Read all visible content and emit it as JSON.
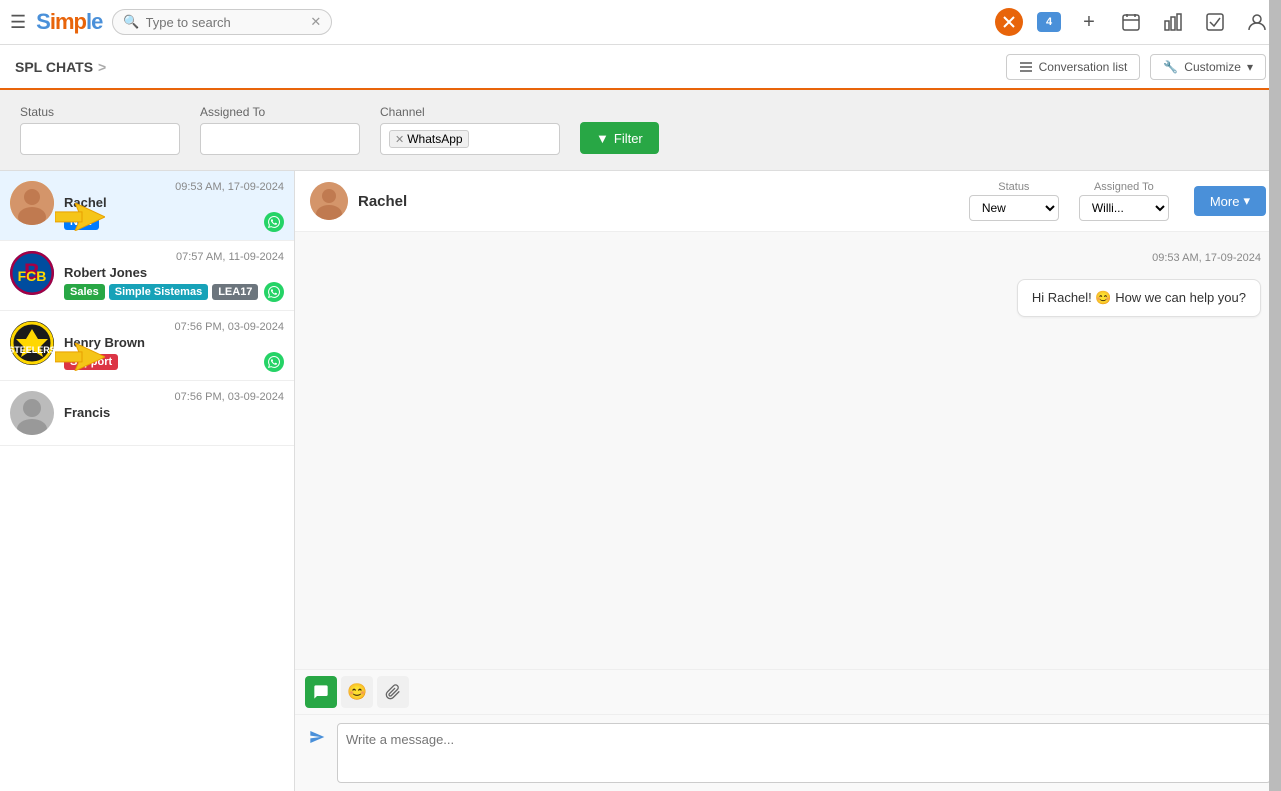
{
  "app": {
    "logo": "Simple",
    "hamburger_label": "☰"
  },
  "search": {
    "placeholder": "Type to search",
    "clear_icon": "✕"
  },
  "nav_icons": {
    "icon1": "✕",
    "icon2": "4",
    "icon3": "+",
    "icon4": "📅",
    "icon5": "📊",
    "icon6": "✓",
    "icon7": "👤"
  },
  "sub_nav": {
    "title": "SPL CHATS",
    "chevron": ">",
    "conversation_list_label": "Conversation list",
    "customize_label": "Customize",
    "list_icon": "☰",
    "wrench_icon": "🔧",
    "chevron_down": "▾"
  },
  "filter_bar": {
    "status_label": "Status",
    "status_placeholder": "",
    "assigned_to_label": "Assigned To",
    "assigned_to_placeholder": "",
    "channel_label": "Channel",
    "channel_value": "WhatsApp",
    "channel_remove": "✕",
    "filter_btn_label": "Filter",
    "filter_icon": "▼"
  },
  "chat_list": {
    "items": [
      {
        "id": "rachel",
        "name": "Rachel",
        "timestamp": "09:53 AM, 17-09-2024",
        "tags": [
          "New"
        ],
        "tag_classes": [
          "tag-new"
        ],
        "has_whatsapp": true,
        "has_arrow": true,
        "avatar_type": "rachel"
      },
      {
        "id": "robert",
        "name": "Robert Jones",
        "timestamp": "07:57 AM, 11-09-2024",
        "tags": [
          "Sales",
          "Simple Sistemas",
          "LEA17"
        ],
        "tag_classes": [
          "tag-sales",
          "tag-sistema",
          "tag-lea"
        ],
        "has_whatsapp": true,
        "has_arrow": false,
        "avatar_type": "barcelona"
      },
      {
        "id": "henry",
        "name": "Henry Brown",
        "timestamp": "07:56 PM, 03-09-2024",
        "tags": [
          "Support"
        ],
        "tag_classes": [
          "tag-support"
        ],
        "has_whatsapp": true,
        "has_arrow": true,
        "avatar_type": "steelers"
      },
      {
        "id": "francis",
        "name": "Francis",
        "timestamp": "07:56 PM, 03-09-2024",
        "tags": [],
        "tag_classes": [],
        "has_whatsapp": false,
        "has_arrow": false,
        "avatar_type": "francis"
      }
    ]
  },
  "conversation": {
    "contact_name": "Rachel",
    "status_label": "Status",
    "status_value": "New",
    "assigned_to_label": "Assigned To",
    "assigned_to_value": "Willi...",
    "more_btn_label": "More",
    "more_chevron": "▾",
    "message_timestamp": "09:53 AM, 17-09-2024",
    "message_text": "Hi Rachel! 😊 How we can help you?",
    "message_input_placeholder": "Write a message...",
    "toolbar": {
      "chat_icon": "💬",
      "emoji_icon": "😊",
      "attach_icon": "📎",
      "send_icon": "✈"
    }
  }
}
